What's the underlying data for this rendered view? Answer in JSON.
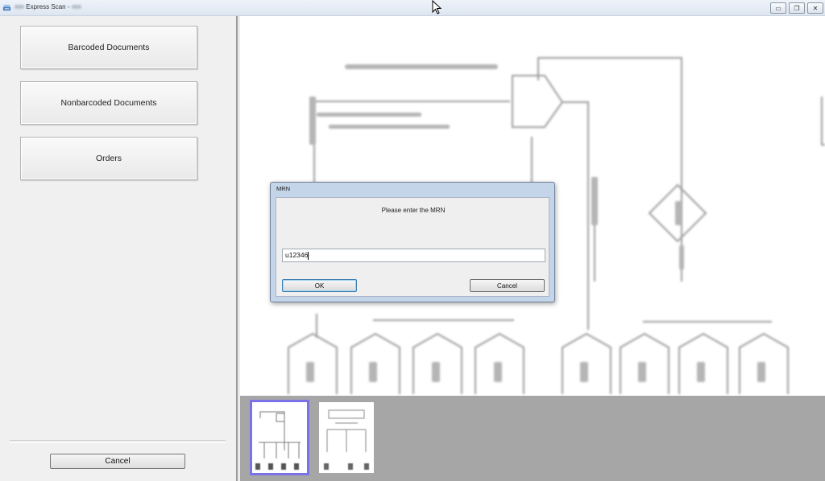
{
  "window": {
    "title": "Express Scan -",
    "controls": {
      "minimize": "▭",
      "restore": "❐",
      "close": "✕"
    },
    "app_icon": "scanner-icon"
  },
  "sidebar": {
    "buttons": [
      {
        "label": "Barcoded Documents"
      },
      {
        "label": "Nonbarcoded Documents"
      },
      {
        "label": "Orders"
      }
    ],
    "cancel_label": "Cancel"
  },
  "dialog": {
    "title": "MRN",
    "prompt": "Please enter the MRN",
    "input_value": "u12346",
    "ok_label": "OK",
    "cancel_label": "Cancel"
  },
  "thumbnails": [
    {
      "selected": true
    },
    {
      "selected": false
    }
  ],
  "colors": {
    "selection_outline": "#7b72e8",
    "dialog_frame": "#c4d5ea",
    "thumb_strip": "#a6a6a6"
  }
}
